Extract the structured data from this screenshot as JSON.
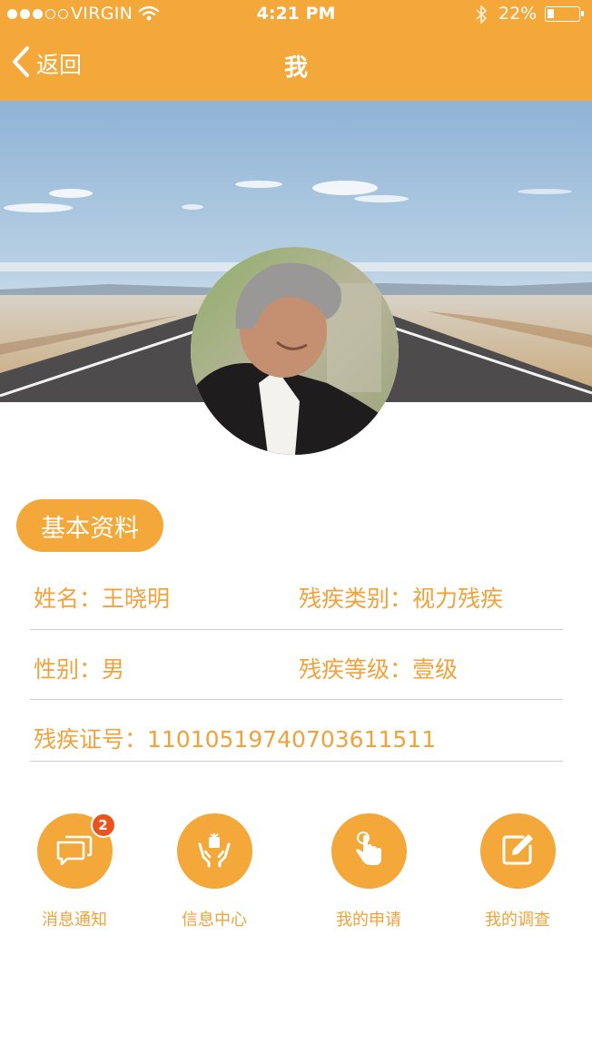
{
  "status_bar": {
    "carrier": "VIRGIN",
    "time": "4:21 PM",
    "battery": "22%",
    "battery_level": 0.22,
    "signal_bars_filled": 3,
    "signal_bars_total": 5
  },
  "nav": {
    "back_label": "返回",
    "title": "我"
  },
  "section": {
    "title": "基本资料"
  },
  "profile": {
    "name": "姓名：王晓明",
    "disability_type": "残疾类别：视力残疾",
    "gender": "性别：男",
    "disability_level": "残疾等级：壹级",
    "certificate_no": "残疾证号：110105197407036115​11"
  },
  "actions": [
    {
      "label": "消息通知",
      "icon": "chat-bubbles-icon",
      "badge": "2"
    },
    {
      "label": "信息中心",
      "icon": "hands-gift-icon"
    },
    {
      "label": "我的申请",
      "icon": "tap-hand-icon"
    },
    {
      "label": "我的调查",
      "icon": "edit-note-icon"
    }
  ],
  "colors": {
    "accent": "#F4A83A",
    "text_accent": "#F0A23B",
    "badge": "#E9541E",
    "divider": "#cfcfcf"
  }
}
